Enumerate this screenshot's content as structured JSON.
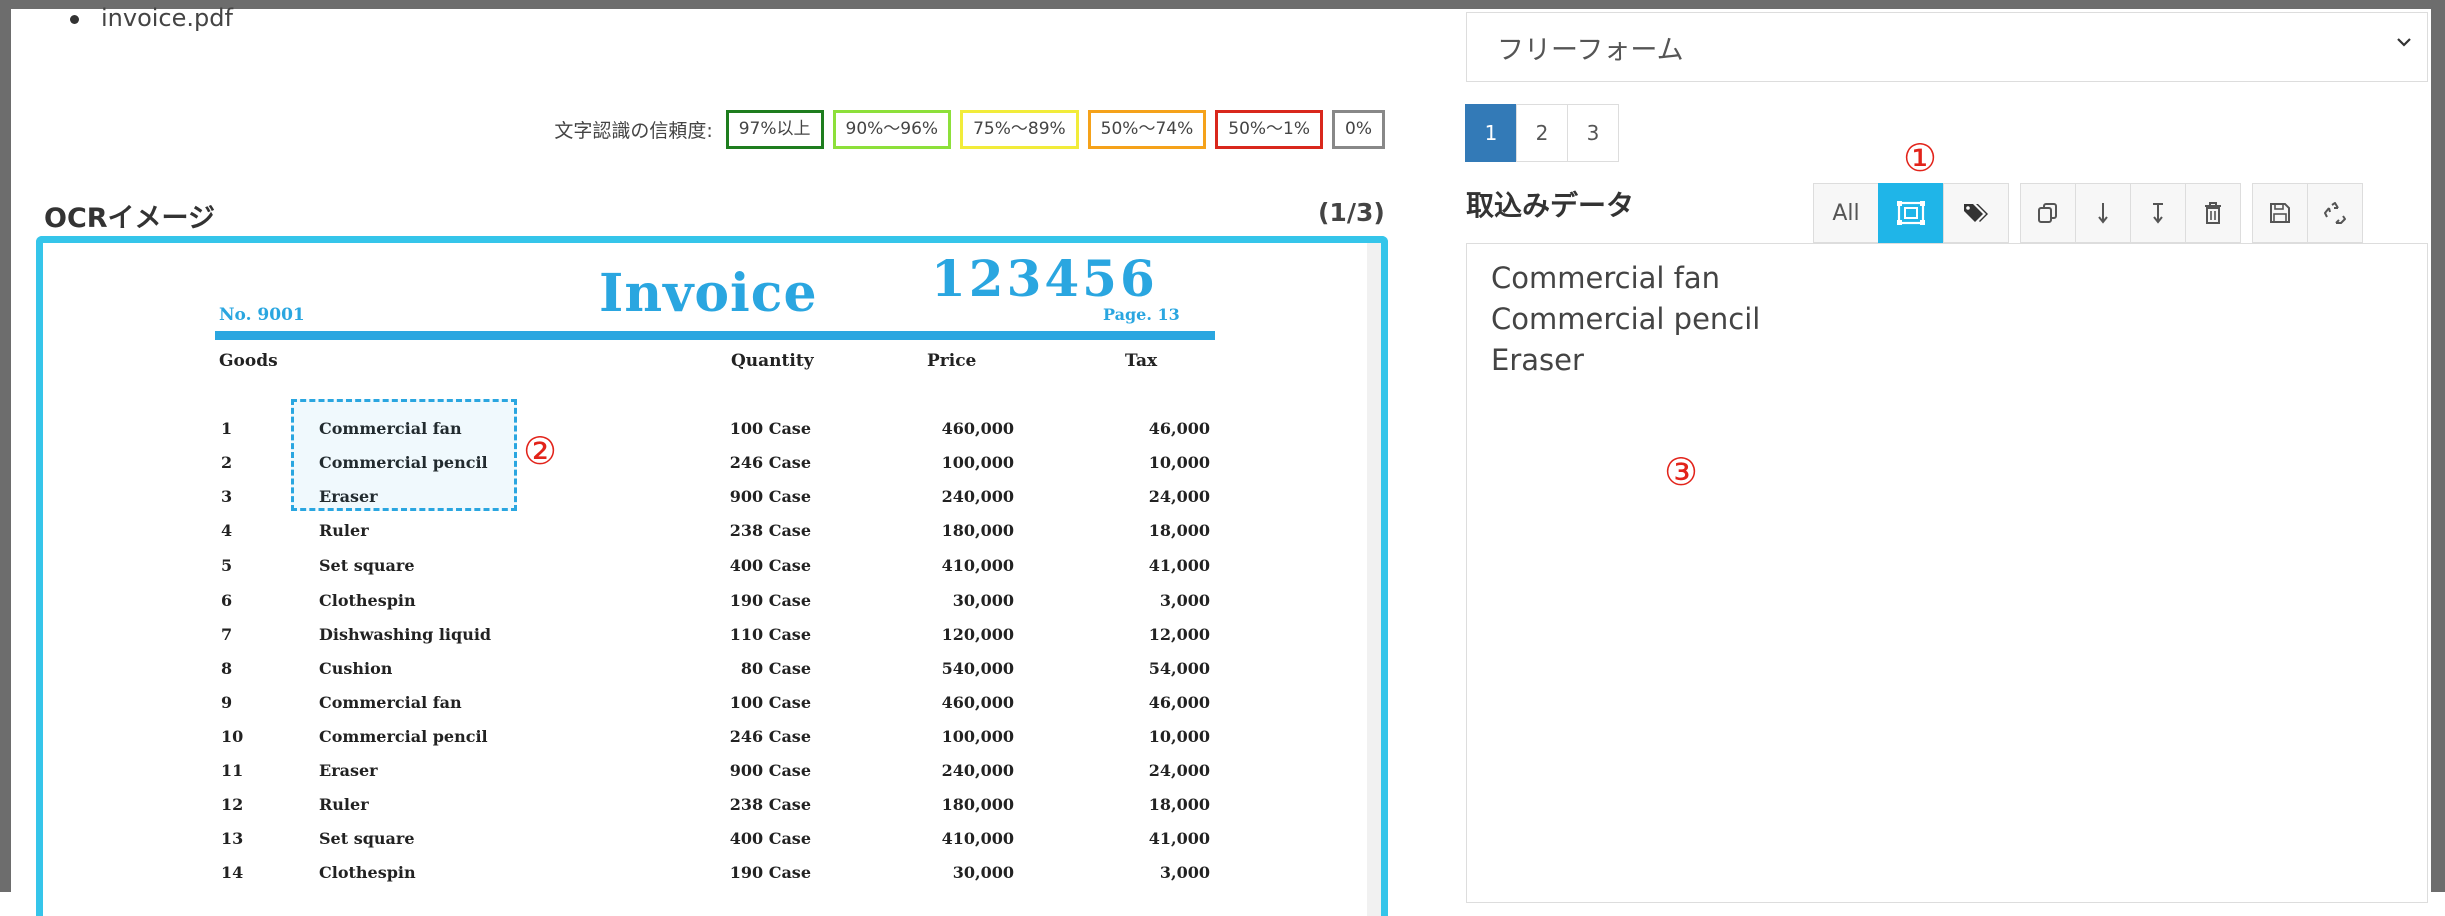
{
  "files": [
    "invoice.pdf"
  ],
  "legend": {
    "label": "文字認識の信頼度:",
    "items": [
      {
        "text": "97%以上",
        "color": "#1e7d1e"
      },
      {
        "text": "90%〜96%",
        "color": "#8de03a"
      },
      {
        "text": "75%〜89%",
        "color": "#f2ec3a"
      },
      {
        "text": "50%〜74%",
        "color": "#f5a21a"
      },
      {
        "text": "50%〜1%",
        "color": "#d9281c"
      },
      {
        "text": "0%",
        "color": "#888888"
      }
    ]
  },
  "ocr": {
    "title": "OCRイメージ",
    "counter": "(1/3)",
    "invoice": {
      "title": "Invoice",
      "number": "123456",
      "no": "No. 9001",
      "page": "Page. 13",
      "headers": {
        "goods": "Goods",
        "quantity": "Quantity",
        "price": "Price",
        "tax": "Tax"
      },
      "rows": [
        {
          "n": "1",
          "goods": "Commercial fan",
          "qty": "100 Case",
          "price": "460,000",
          "tax": "46,000"
        },
        {
          "n": "2",
          "goods": "Commercial pencil",
          "qty": "246 Case",
          "price": "100,000",
          "tax": "10,000"
        },
        {
          "n": "3",
          "goods": "Eraser",
          "qty": "900 Case",
          "price": "240,000",
          "tax": "24,000"
        },
        {
          "n": "4",
          "goods": "Ruler",
          "qty": "238 Case",
          "price": "180,000",
          "tax": "18,000"
        },
        {
          "n": "5",
          "goods": "Set square",
          "qty": "400 Case",
          "price": "410,000",
          "tax": "41,000"
        },
        {
          "n": "6",
          "goods": "Clothespin",
          "qty": "190 Case",
          "price": "30,000",
          "tax": "3,000"
        },
        {
          "n": "7",
          "goods": "Dishwashing liquid",
          "qty": "110 Case",
          "price": "120,000",
          "tax": "12,000"
        },
        {
          "n": "8",
          "goods": "Cushion",
          "qty": "80 Case",
          "price": "540,000",
          "tax": "54,000"
        },
        {
          "n": "9",
          "goods": "Commercial fan",
          "qty": "100 Case",
          "price": "460,000",
          "tax": "46,000"
        },
        {
          "n": "10",
          "goods": "Commercial pencil",
          "qty": "246 Case",
          "price": "100,000",
          "tax": "10,000"
        },
        {
          "n": "11",
          "goods": "Eraser",
          "qty": "900 Case",
          "price": "240,000",
          "tax": "24,000"
        },
        {
          "n": "12",
          "goods": "Ruler",
          "qty": "238 Case",
          "price": "180,000",
          "tax": "18,000"
        },
        {
          "n": "13",
          "goods": "Set square",
          "qty": "400 Case",
          "price": "410,000",
          "tax": "41,000"
        },
        {
          "n": "14",
          "goods": "Clothespin",
          "qty": "190 Case",
          "price": "30,000",
          "tax": "3,000"
        }
      ]
    },
    "callout_selection": "②"
  },
  "right": {
    "form_select": "フリーフォーム",
    "pages": [
      "1",
      "2",
      "3"
    ],
    "active_page": "1",
    "data_title": "取込みデータ",
    "toolbar": {
      "all_label": "All",
      "active_tool": "region-select"
    },
    "callout_toolbar": "①",
    "callout_data": "③",
    "extracted_text": "Commercial fan\nCommercial pencil\nEraser"
  }
}
